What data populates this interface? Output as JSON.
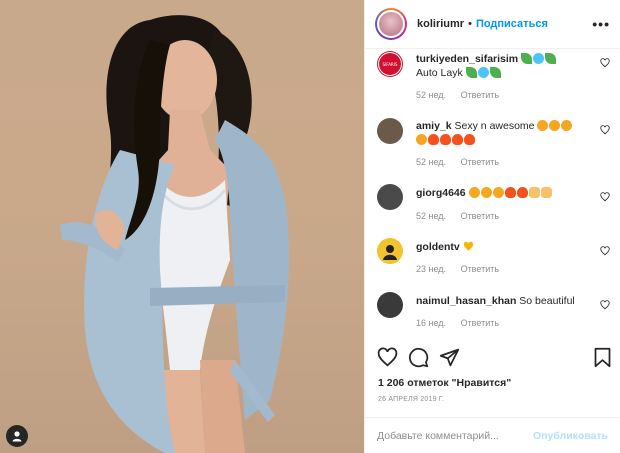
{
  "post": {
    "username": "koliriumr",
    "dot": "•",
    "follow_label": "Подписаться",
    "more_label": "•••"
  },
  "comments": [
    {
      "username": "turkiyeden_sifarisim",
      "text": "Auto Layk",
      "age": "52 нед.",
      "reply": "Ответить",
      "avatar_color": "#c8102e"
    },
    {
      "username": "amiy_k",
      "text": "Sexy n awesome",
      "age": "52 нед.",
      "reply": "Ответить",
      "avatar_color": "#6b5a4a"
    },
    {
      "username": "giorg4646",
      "text": "",
      "age": "52 нед.",
      "reply": "Ответить",
      "avatar_color": "#4a4a4a"
    },
    {
      "username": "goldentv",
      "text": "",
      "age": "23 нед.",
      "reply": "Ответить",
      "avatar_color": "#f2c230"
    },
    {
      "username": "naimul_hasan_khan",
      "text": "So beautiful",
      "age": "16 нед.",
      "reply": "Ответить",
      "avatar_color": "#3a3a3a"
    }
  ],
  "likes_text": "1 206 отметок \"Нравится\"",
  "date_text": "26 АПРЕЛЯ 2019 Г.",
  "comment_box": {
    "placeholder": "Добавьте комментарий...",
    "post_label": "Опубликовать"
  },
  "colors": {
    "link_blue": "#0095f6",
    "post_disabled": "#b2dffc",
    "muted": "#8e8e8e",
    "robe_blue": "#a9bfd2"
  },
  "icons": [
    "heart-icon",
    "comment-icon",
    "share-icon",
    "bookmark-icon",
    "user-tag-icon"
  ]
}
